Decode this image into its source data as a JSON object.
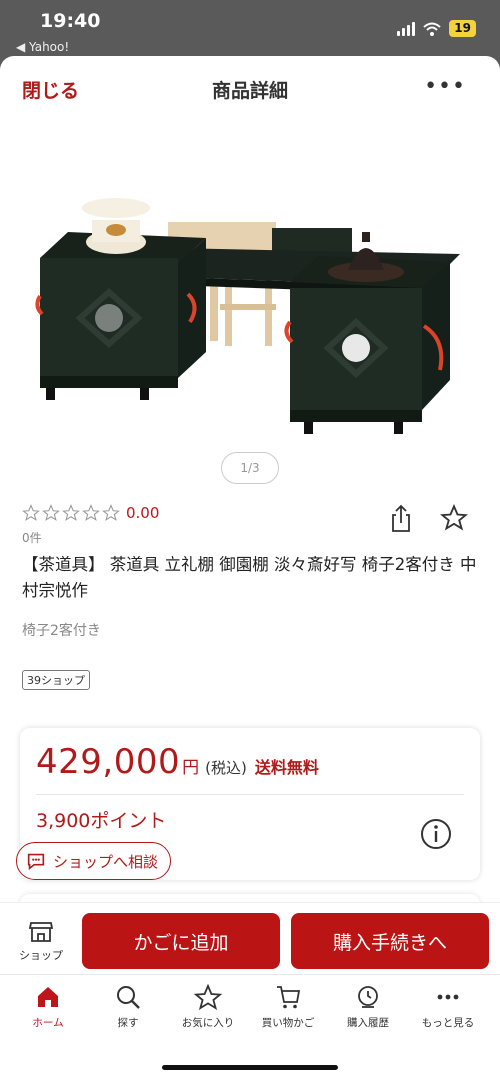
{
  "status_bar": {
    "time": "19:40",
    "back_label": "◀ Yahoo!",
    "battery": "19"
  },
  "header": {
    "close_label": "閉じる",
    "title": "商品詳細",
    "more_label": "•••"
  },
  "gallery": {
    "pager": "1/3"
  },
  "rating": {
    "value": "0.00",
    "count": "0件"
  },
  "product": {
    "title": "【茶道具】 茶道具 立礼棚 御園棚 淡々斎好写 椅子2客付き 中村宗悦作",
    "subtitle": "椅子2客付き",
    "shop_badge": "39ショップ"
  },
  "price": {
    "amount": "429,000",
    "currency": "円",
    "tax_label": "(税込)",
    "shipping_label": "送料無料",
    "points": "3,900ポイント"
  },
  "consult": {
    "label": "ショップへ相談"
  },
  "actions": {
    "shop_label": "ショップ",
    "add_to_cart": "かごに追加",
    "checkout": "購入手続きへ"
  },
  "tabs": [
    {
      "label": "ホーム",
      "icon": "home-icon"
    },
    {
      "label": "探す",
      "icon": "search-icon"
    },
    {
      "label": "お気に入り",
      "icon": "star-icon"
    },
    {
      "label": "買い物かご",
      "icon": "cart-icon"
    },
    {
      "label": "購入履歴",
      "icon": "history-icon"
    },
    {
      "label": "もっと見る",
      "icon": "more-icon"
    }
  ],
  "colors": {
    "accent": "#bb1414",
    "price": "#b01a1a",
    "status_bg": "#5a5a5a",
    "battery": "#f2d33c"
  }
}
